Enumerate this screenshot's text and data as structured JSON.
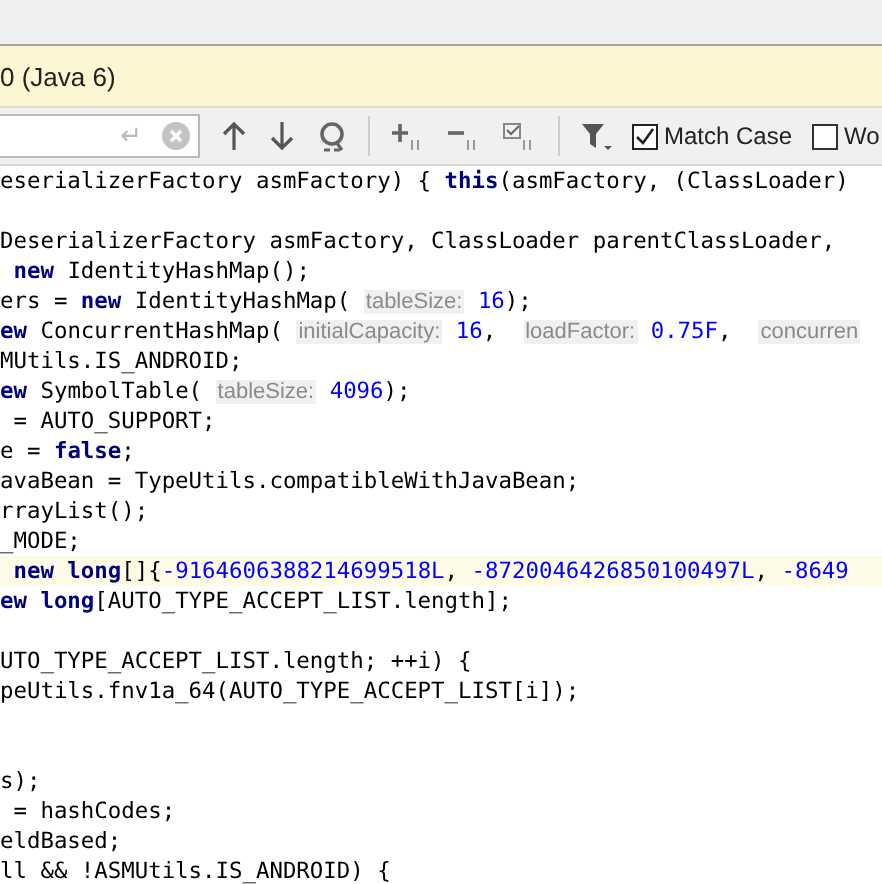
{
  "banner": {
    "text": "0 (Java 6)"
  },
  "search": {
    "enter_glyph": "↵",
    "match_case": {
      "label": "Match Case",
      "checked": true
    },
    "words": {
      "label": "Wo",
      "checked": false
    }
  },
  "code_lines": [
    {
      "current": false,
      "tokens": [
        {
          "kind": "plain",
          "text": "eserializerFactory asmFactory) { "
        },
        {
          "kind": "kw",
          "text": "this"
        },
        {
          "kind": "plain",
          "text": "(asmFactory, (ClassLoader)"
        }
      ]
    },
    {
      "current": false
    },
    {
      "current": false,
      "tokens": [
        {
          "kind": "plain",
          "text": "DeserializerFactory asmFactory, ClassLoader parentClassLoader,"
        }
      ]
    },
    {
      "current": false,
      "tokens": [
        {
          "kind": "kw",
          "text": " new"
        },
        {
          "kind": "plain",
          "text": " IdentityHashMap();"
        }
      ]
    },
    {
      "current": false,
      "tokens": [
        {
          "kind": "plain",
          "text": "ers = "
        },
        {
          "kind": "kw",
          "text": "new"
        },
        {
          "kind": "plain",
          "text": " IdentityHashMap( "
        },
        {
          "kind": "hint",
          "text": "tableSize:"
        },
        {
          "kind": "num",
          "text": " 16"
        },
        {
          "kind": "plain",
          "text": ");"
        }
      ]
    },
    {
      "current": false,
      "tokens": [
        {
          "kind": "kw",
          "text": "ew"
        },
        {
          "kind": "plain",
          "text": " ConcurrentHashMap( "
        },
        {
          "kind": "hint",
          "text": "initialCapacity:"
        },
        {
          "kind": "num",
          "text": " 16"
        },
        {
          "kind": "plain",
          "text": ",  "
        },
        {
          "kind": "hint",
          "text": "loadFactor:"
        },
        {
          "kind": "num",
          "text": " 0.75F"
        },
        {
          "kind": "plain",
          "text": ",  "
        },
        {
          "kind": "hint",
          "text": "concurren"
        }
      ]
    },
    {
      "current": false,
      "tokens": [
        {
          "kind": "plain",
          "text": "MUtils.IS_ANDROID;"
        }
      ]
    },
    {
      "current": false,
      "tokens": [
        {
          "kind": "kw",
          "text": "ew"
        },
        {
          "kind": "plain",
          "text": " SymbolTable( "
        },
        {
          "kind": "hint",
          "text": "tableSize:"
        },
        {
          "kind": "num",
          "text": " 4096"
        },
        {
          "kind": "plain",
          "text": ");"
        }
      ]
    },
    {
      "current": false,
      "tokens": [
        {
          "kind": "plain",
          "text": " = AUTO_SUPPORT;"
        }
      ]
    },
    {
      "current": false,
      "tokens": [
        {
          "kind": "plain",
          "text": "e = "
        },
        {
          "kind": "kw",
          "text": "false"
        },
        {
          "kind": "plain",
          "text": ";"
        }
      ]
    },
    {
      "current": false,
      "tokens": [
        {
          "kind": "plain",
          "text": "avaBean = TypeUtils.compatibleWithJavaBean;"
        }
      ]
    },
    {
      "current": false,
      "tokens": [
        {
          "kind": "plain",
          "text": "rrayList();"
        }
      ]
    },
    {
      "current": false,
      "tokens": [
        {
          "kind": "plain",
          "text": "_MODE;"
        }
      ]
    },
    {
      "current": true,
      "tokens": [
        {
          "kind": "kw",
          "text": " new long"
        },
        {
          "kind": "plain",
          "text": "[]{"
        },
        {
          "kind": "num",
          "text": "-9164606388214699518L"
        },
        {
          "kind": "plain",
          "text": ", "
        },
        {
          "kind": "num",
          "text": "-8720046426850100497L"
        },
        {
          "kind": "plain",
          "text": ", "
        },
        {
          "kind": "num",
          "text": "-8649"
        }
      ]
    },
    {
      "current": false,
      "tokens": [
        {
          "kind": "kw",
          "text": "ew long"
        },
        {
          "kind": "plain",
          "text": "[AUTO_TYPE_ACCEPT_LIST.length];"
        }
      ]
    },
    {
      "current": false
    },
    {
      "current": false,
      "tokens": [
        {
          "kind": "plain",
          "text": "UTO_TYPE_ACCEPT_LIST.length; ++i) {"
        }
      ]
    },
    {
      "current": false,
      "tokens": [
        {
          "kind": "plain",
          "text": "peUtils.fnv1a_64(AUTO_TYPE_ACCEPT_LIST[i]);"
        }
      ]
    },
    {
      "current": false
    },
    {
      "current": false
    },
    {
      "current": false,
      "tokens": [
        {
          "kind": "plain",
          "text": "s);"
        }
      ]
    },
    {
      "current": false,
      "tokens": [
        {
          "kind": "plain",
          "text": " = hashCodes;"
        }
      ]
    },
    {
      "current": false,
      "tokens": [
        {
          "kind": "plain",
          "text": "eldBased;"
        }
      ]
    },
    {
      "current": false,
      "tokens": [
        {
          "kind": "plain",
          "text": "ll && !ASMUtils.IS_ANDROID) {"
        }
      ]
    }
  ]
}
